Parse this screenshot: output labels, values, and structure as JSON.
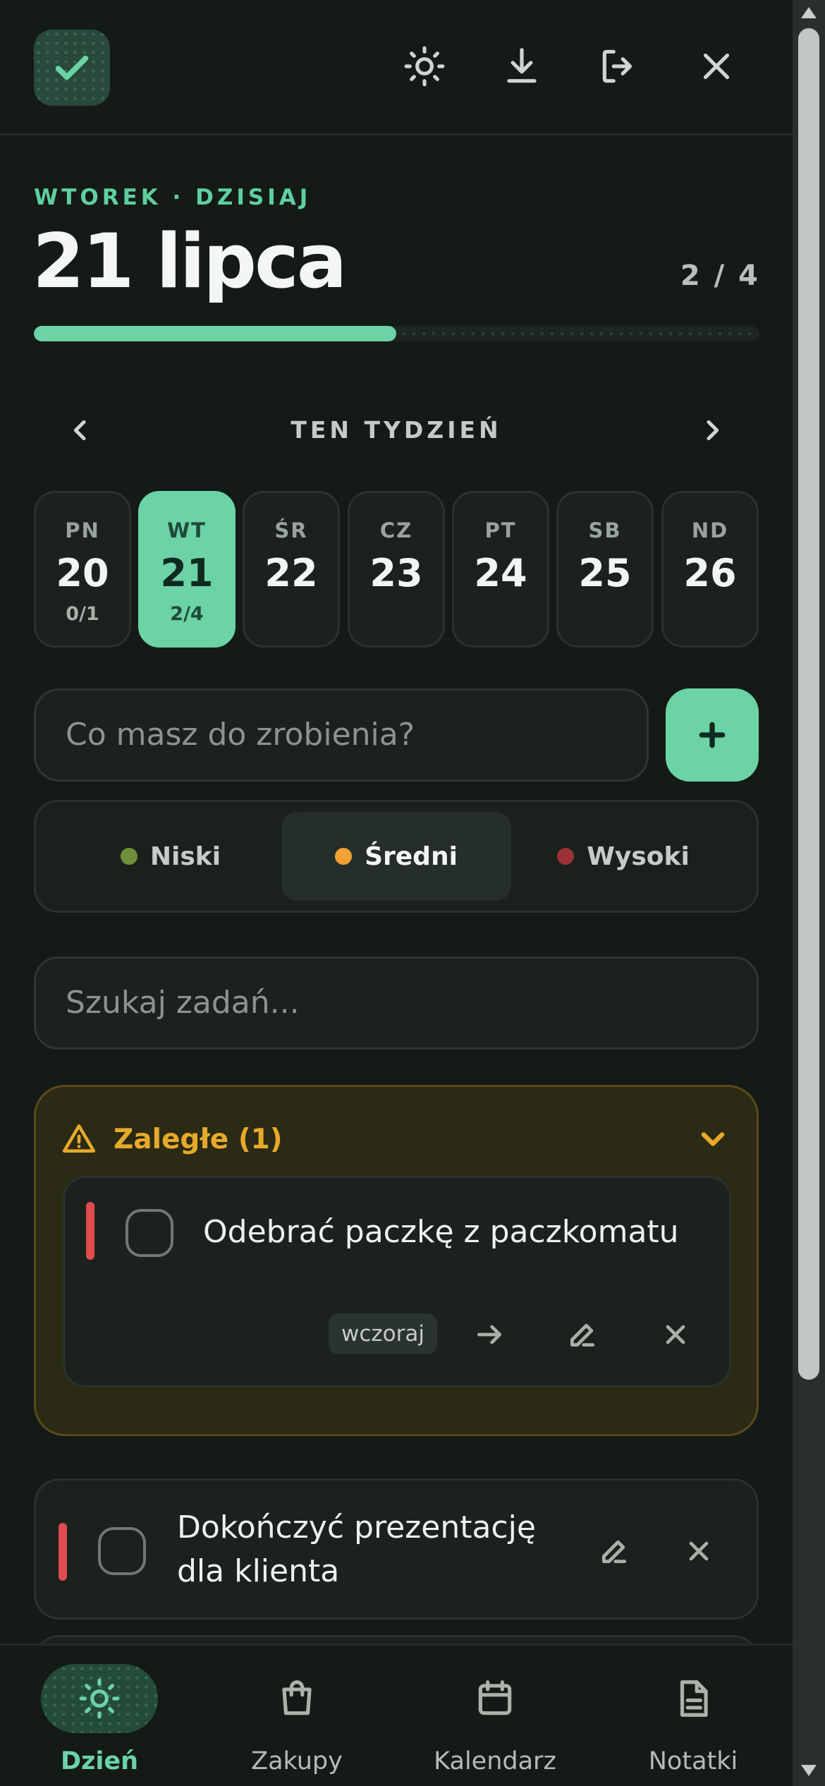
{
  "header": {
    "icons": [
      "check-icon",
      "sun-icon",
      "download-icon",
      "logout-icon",
      "close-icon"
    ]
  },
  "day_view": {
    "eyebrow": "WTOREK · DZISIAJ",
    "title": "21 lipca",
    "count": "2 / 4",
    "progress_fraction": 0.5
  },
  "week": {
    "label": "TEN TYDZIEŃ",
    "days": [
      {
        "name": "PN",
        "num": "20",
        "count": "0/1"
      },
      {
        "name": "WT",
        "num": "21",
        "count": "2/4"
      },
      {
        "name": "ŚR",
        "num": "22",
        "count": ""
      },
      {
        "name": "CZ",
        "num": "23",
        "count": ""
      },
      {
        "name": "PT",
        "num": "24",
        "count": ""
      },
      {
        "name": "SB",
        "num": "25",
        "count": ""
      },
      {
        "name": "ND",
        "num": "26",
        "count": ""
      }
    ],
    "active_index": 1
  },
  "add_task": {
    "placeholder": "Co masz do zrobienia?"
  },
  "priority": {
    "options": [
      {
        "label": "Niski",
        "color": "#6f8f3a"
      },
      {
        "label": "Średni",
        "color": "#f2a234"
      },
      {
        "label": "Wysoki",
        "color": "#9c3236"
      }
    ],
    "selected": "Średni"
  },
  "search": {
    "placeholder": "Szukaj zadań..."
  },
  "overdue": {
    "title": "Zaległe (1)",
    "tasks": [
      {
        "text": "Odebrać paczkę z paczkomatu",
        "tag": "wczoraj",
        "priority_color": "#e04b4f"
      }
    ]
  },
  "tasks": [
    {
      "text": "Dokończyć prezentację dla klienta",
      "priority_color": "#e04b4f"
    }
  ],
  "bottom_nav": {
    "items": [
      {
        "label": "Dzień",
        "icon": "sun-icon"
      },
      {
        "label": "Zakupy",
        "icon": "shopping-bag-icon"
      },
      {
        "label": "Kalendarz",
        "icon": "calendar-icon"
      },
      {
        "label": "Notatki",
        "icon": "note-icon"
      }
    ],
    "active": "Dzień"
  },
  "colors": {
    "accent": "#6bd3a6",
    "background": "#141a16",
    "warning": "#e7a92b",
    "high_priority": "#e04b4f"
  }
}
